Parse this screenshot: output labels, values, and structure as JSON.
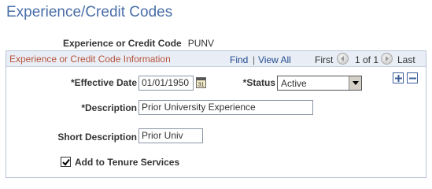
{
  "page": {
    "title": "Experience/Credit Codes"
  },
  "code": {
    "label": "Experience or Credit Code",
    "value": "PUNV"
  },
  "group": {
    "title": "Experience or Credit Code Information",
    "find_label": "Find",
    "separator": "|",
    "view_all_label": "View All",
    "first_label": "First",
    "position_text": "1 of 1",
    "last_label": "Last"
  },
  "form": {
    "effective_date_label": "*Effective Date",
    "effective_date_value": "01/01/1950",
    "calendar_icon_text": "31",
    "status_label": "*Status",
    "status_value": "Active",
    "description_label": "*Description",
    "description_value": "Prior University Experience",
    "short_description_label": "Short Description",
    "short_description_value": "Prior Univ",
    "tenure_label": "Add to Tenure Services",
    "tenure_checked": true
  },
  "icons": {
    "calendar": "calendar-icon",
    "dropdown": "chevron-down-icon",
    "prev": "arrow-left-icon",
    "next": "arrow-right-icon",
    "add": "plus-icon",
    "remove": "minus-icon",
    "check": "checkmark-icon"
  },
  "colors": {
    "title": "#4a6ea8",
    "group_title": "#b5533a",
    "link": "#254c8e",
    "group_header_bg": "#e9eef6",
    "border": "#b8c4d6"
  }
}
